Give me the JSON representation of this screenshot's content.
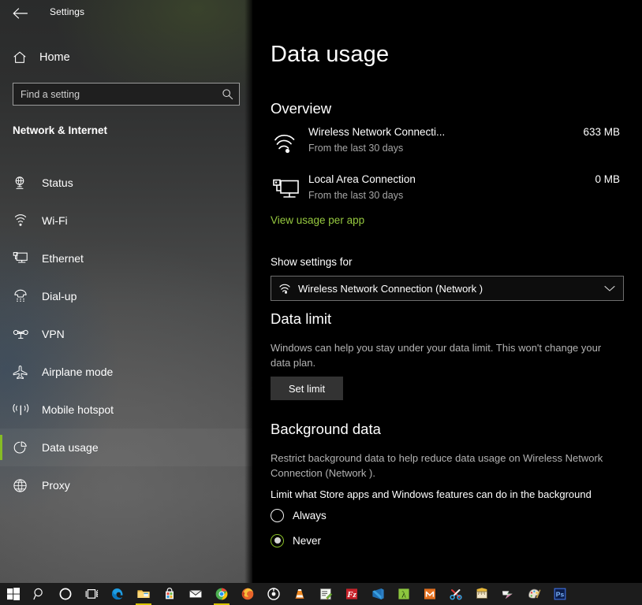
{
  "window": {
    "title": "Settings",
    "back_icon": "back-arrow-icon"
  },
  "sidebar": {
    "home": {
      "label": "Home",
      "icon": "home-icon"
    },
    "search": {
      "value": "",
      "placeholder": "Find a setting",
      "icon": "search-icon"
    },
    "category": "Network & Internet",
    "items": [
      {
        "label": "Status",
        "icon": "status-globe-icon",
        "selected": false
      },
      {
        "label": "Wi-Fi",
        "icon": "wifi-icon",
        "selected": false
      },
      {
        "label": "Ethernet",
        "icon": "ethernet-icon",
        "selected": false
      },
      {
        "label": "Dial-up",
        "icon": "dialup-phone-icon",
        "selected": false
      },
      {
        "label": "VPN",
        "icon": "vpn-icon",
        "selected": false
      },
      {
        "label": "Airplane mode",
        "icon": "airplane-icon",
        "selected": false
      },
      {
        "label": "Mobile hotspot",
        "icon": "hotspot-icon",
        "selected": false
      },
      {
        "label": "Data usage",
        "icon": "pie-chart-icon",
        "selected": true
      },
      {
        "label": "Proxy",
        "icon": "globe-icon",
        "selected": false
      }
    ],
    "accent_color": "#86bc25"
  },
  "main": {
    "page_title": "Data usage",
    "overview": {
      "heading": "Overview",
      "connections": [
        {
          "name": "Wireless Network Connecti...",
          "subtitle": "From the last 30 days",
          "amount": "633 MB",
          "icon": "wifi-icon"
        },
        {
          "name": "Local Area Connection",
          "subtitle": "From the last 30 days",
          "amount": "0 MB",
          "icon": "ethernet-icon"
        }
      ],
      "link": "View usage per app",
      "link_color": "#96c93f"
    },
    "show_settings": {
      "label": "Show settings for",
      "selected": "Wireless Network Connection (Network )",
      "icon": "wifi-icon",
      "chevron": "chevron-down-icon"
    },
    "data_limit": {
      "heading": "Data limit",
      "description": "Windows can help you stay under your data limit. This won't change your data plan.",
      "button": "Set limit"
    },
    "background_data": {
      "heading": "Background data",
      "description": "Restrict background data to help reduce data usage on Wireless Network Connection (Network ).",
      "radio_label": "Limit what Store apps and Windows features can do in the background",
      "options": [
        {
          "label": "Always",
          "checked": false
        },
        {
          "label": "Never",
          "checked": true
        }
      ]
    }
  },
  "taskbar": {
    "items": [
      {
        "name": "start-button",
        "icon": "windows-logo-icon",
        "running": false
      },
      {
        "name": "search-button",
        "icon": "search-icon",
        "running": false
      },
      {
        "name": "cortana-button",
        "icon": "cortana-circle-icon",
        "running": false
      },
      {
        "name": "task-view-button",
        "icon": "task-view-icon",
        "running": false
      },
      {
        "name": "edge-button",
        "icon": "edge-icon",
        "running": false
      },
      {
        "name": "file-explorer-button",
        "icon": "folder-icon",
        "running": true
      },
      {
        "name": "microsoft-store-button",
        "icon": "store-bag-icon",
        "running": false
      },
      {
        "name": "mail-button",
        "icon": "mail-envelope-icon",
        "running": false
      },
      {
        "name": "chrome-button",
        "icon": "chrome-icon",
        "running": true
      },
      {
        "name": "firefox-button",
        "icon": "firefox-icon",
        "running": false
      },
      {
        "name": "target-app-button",
        "icon": "target-circle-icon",
        "running": false
      },
      {
        "name": "vlc-button",
        "icon": "vlc-cone-icon",
        "running": false
      },
      {
        "name": "notepadpp-button",
        "icon": "notepad-pencil-icon",
        "running": false
      },
      {
        "name": "filezilla-button",
        "icon": "filezilla-icon",
        "running": false
      },
      {
        "name": "vscode-button",
        "icon": "vscode-icon",
        "running": false
      },
      {
        "name": "lambda-app-button",
        "icon": "lambda-icon",
        "running": false
      },
      {
        "name": "xmind-button",
        "icon": "xmind-icon",
        "running": false
      },
      {
        "name": "snip-tool-button",
        "icon": "scissors-icon",
        "running": false
      },
      {
        "name": "ruler-app-button",
        "icon": "ruler-icon",
        "running": false
      },
      {
        "name": "movie-maker-button",
        "icon": "arrow-gradient-icon",
        "running": false
      },
      {
        "name": "paint-button",
        "icon": "paint-palette-icon",
        "running": false
      },
      {
        "name": "photoshop-button",
        "icon": "photoshop-ps-icon",
        "running": false
      }
    ]
  }
}
